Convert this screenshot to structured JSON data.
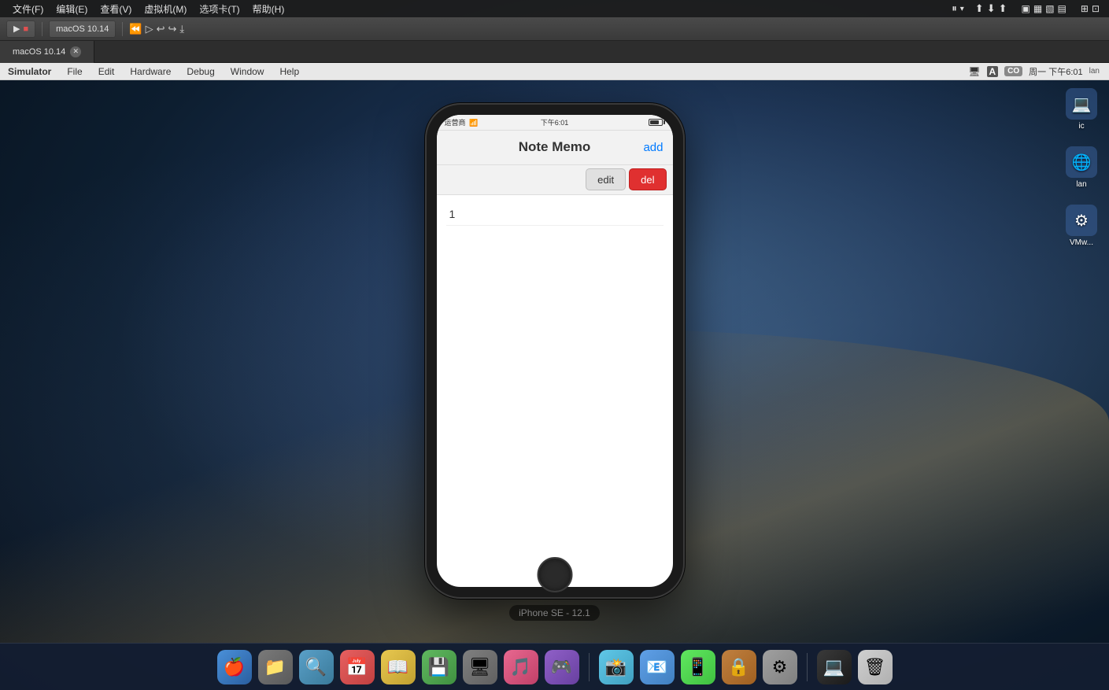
{
  "menubar": {
    "items": [
      "文件(F)",
      "编辑(E)",
      "查看(V)",
      "虚拟机(M)",
      "选项卡(T)",
      "帮助(H)"
    ],
    "right": {
      "co_label": "CO",
      "time_label": "周一 下午6:01"
    }
  },
  "xcode_toolbar": {
    "run_label": "▶",
    "stop_label": "■",
    "scheme_label": "macOS 10.14",
    "icons": [
      "⏸",
      "▷",
      "↩",
      "↗",
      "⬇"
    ]
  },
  "tabs": [
    {
      "label": "macOS 10.14",
      "active": true
    }
  ],
  "sim_menubar": {
    "items": [
      "Simulator",
      "File",
      "Edit",
      "Hardware",
      "Debug",
      "Window",
      "Help"
    ],
    "right_time": "周一 下午6:01"
  },
  "phone": {
    "status_bar": {
      "carrier": "运营商",
      "wifi": "▲",
      "time": "下午6:01",
      "battery_level": "85%"
    },
    "nav": {
      "title": "Note Memo",
      "add_label": "add"
    },
    "action_bar": {
      "edit_label": "edit",
      "del_label": "del"
    },
    "notes": [
      {
        "id": 1,
        "text": "1"
      }
    ],
    "label": "iPhone SE - 12.1"
  },
  "dock_icons": [
    "🍎",
    "📁",
    "🔍",
    "📅",
    "📖",
    "💾",
    "🖥",
    "🎵",
    "🎮",
    "📸",
    "📧",
    "📱",
    "🔒",
    "⚙",
    "💻"
  ],
  "right_desktop_icons": [
    {
      "name": "ic",
      "label": "ic"
    },
    {
      "name": "lan",
      "label": "lan"
    },
    {
      "name": "VMw",
      "label": "VMw..."
    }
  ]
}
